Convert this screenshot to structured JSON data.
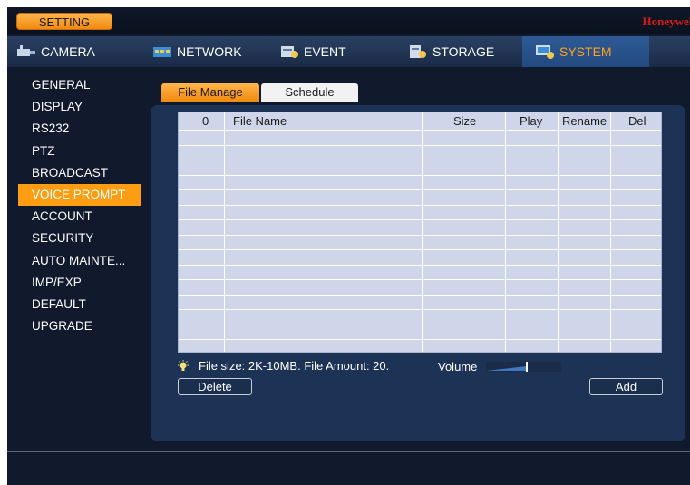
{
  "topbar": {
    "setting_label": "SETTING",
    "brand": "Honeywell",
    "brand_color": "#d81c1c"
  },
  "main_tabs": [
    {
      "label": "CAMERA",
      "icon": "camera-icon"
    },
    {
      "label": "NETWORK",
      "icon": "network-icon"
    },
    {
      "label": "EVENT",
      "icon": "event-icon"
    },
    {
      "label": "STORAGE",
      "icon": "storage-icon"
    },
    {
      "label": "SYSTEM",
      "icon": "system-icon",
      "active": true
    }
  ],
  "sidebar": {
    "items": [
      {
        "label": "GENERAL"
      },
      {
        "label": "DISPLAY"
      },
      {
        "label": "RS232"
      },
      {
        "label": "PTZ"
      },
      {
        "label": "BROADCAST"
      },
      {
        "label": "VOICE PROMPT",
        "active": true
      },
      {
        "label": "ACCOUNT"
      },
      {
        "label": "SECURITY"
      },
      {
        "label": "AUTO MAINTE..."
      },
      {
        "label": "IMP/EXP"
      },
      {
        "label": "DEFAULT"
      },
      {
        "label": "UPGRADE"
      }
    ]
  },
  "sub_tabs": [
    {
      "label": "File Manage",
      "active": true
    },
    {
      "label": "Schedule"
    }
  ],
  "table": {
    "columns": [
      "0",
      "File Name",
      "Size",
      "Play",
      "Rename",
      "Del"
    ],
    "rows": []
  },
  "info": {
    "hint": "File size: 2K-10MB. File Amount: 20.",
    "volume_label": "Volume"
  },
  "buttons": {
    "delete": "Delete",
    "add": "Add"
  },
  "colors": {
    "accent": "#ff9d12",
    "panel": "#1d3356",
    "background": "#101a2c"
  }
}
